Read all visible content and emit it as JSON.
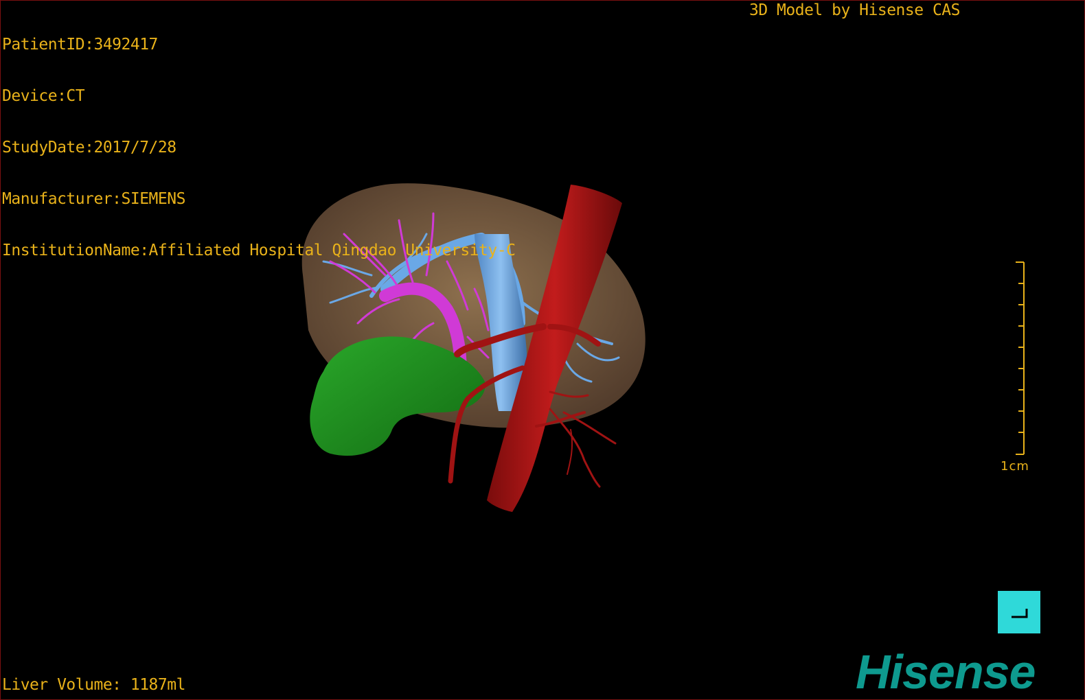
{
  "overlay": {
    "patient_id": "PatientID:3492417",
    "device": "Device:CT",
    "study_date": "StudyDate:2017/7/28",
    "manufacturer": "Manufacturer:SIEMENS",
    "institution": "InstitutionName:Affiliated Hospital Qingdao University-C",
    "model_credit": "3D Model by Hisense CAS",
    "liver_volume": "Liver Volume: 1187ml"
  },
  "scale_bar": {
    "label": "1cm"
  },
  "brand": {
    "logo_text": "Hisense"
  },
  "colors": {
    "overlay_text": "#e9b21a",
    "liver": "#8a6a48",
    "hepatic_vein": "#6aa8e6",
    "portal_vein": "#d03ad6",
    "artery": "#a01313",
    "gallbladder": "#1e8f1e",
    "brand": "#0e9a8f",
    "button": "#2fd9d9"
  },
  "icons": {
    "corner_button": "corner-arrow-icon"
  }
}
